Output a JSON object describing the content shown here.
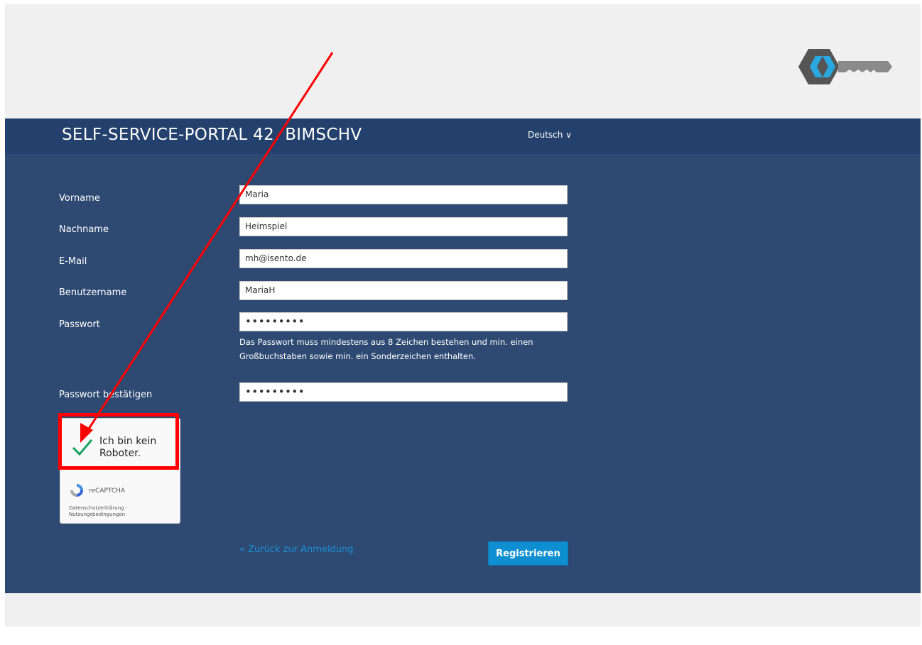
{
  "header": {
    "title": "SELF-SERVICE-PORTAL 42. BIMSCHV",
    "language": "Deutsch ∨"
  },
  "form": {
    "fields": [
      {
        "label": "Vorname",
        "value": "Maria"
      },
      {
        "label": "Nachname",
        "value": "Heimspiel"
      },
      {
        "label": "E-Mail",
        "value": "mh@isento.de"
      },
      {
        "label": "Benutzername",
        "value": "MariaH"
      },
      {
        "label": "Passwort",
        "value": "•••••••••"
      },
      {
        "label": "Passwort bestätigen",
        "value": "•••••••••"
      }
    ],
    "password_hint": "Das Passwort muss mindestens aus 8 Zeichen bestehen und min. einen Großbuchstaben sowie min. ein Sonderzeichen enthalten.",
    "back_link": "« Zurück zur Anmeldung",
    "submit_label": "Registrieren"
  },
  "captcha": {
    "label": "Ich bin kein Roboter.",
    "brand": "reCAPTCHA",
    "links": "Datenschutzerklärung - Nutzungsbedingungen"
  },
  "icons": {
    "logo": "key-logo-icon",
    "check": "checkmark-icon",
    "captcha": "recaptcha-icon"
  },
  "colors": {
    "header_bg": "#23416c",
    "main_bg": "#2e4a73",
    "button": "#0d8fd1",
    "link": "#1a8fd6",
    "annotation": "#ff0000",
    "check": "#1aa260"
  }
}
